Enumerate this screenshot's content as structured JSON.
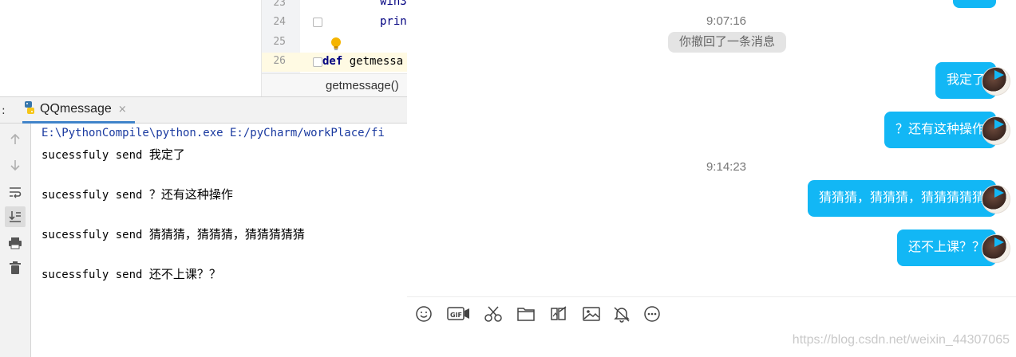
{
  "ide": {
    "editor": {
      "line_numbers": [
        "23",
        "24",
        "25",
        "26"
      ],
      "code_lines": [
        "win3",
        "prin"
      ],
      "def_keyword": "def",
      "def_name": "getmessa",
      "breadcrumb": "getmessage()"
    },
    "run_panel": {
      "colon": ":",
      "tab_label": "QQmessage",
      "tab_close": "×"
    },
    "console": {
      "command": "E:\\PythonCompile\\python.exe E:/pyCharm/workPlace/fi",
      "lines": [
        {
          "prefix": "sucessfuly send ",
          "msg": "我定了"
        },
        {
          "prefix": "sucessfuly send ",
          "msg": "？还有这种操作"
        },
        {
          "prefix": "sucessfuly send ",
          "msg": "猜猜猜，猜猜猜，猜猜猜猜猜"
        },
        {
          "prefix": "sucessfuly send ",
          "msg": "还不上课？？"
        }
      ]
    }
  },
  "chat": {
    "timestamp1": "9:07:16",
    "recall_notice": "你撤回了一条消息",
    "timestamp2": "9:14:23",
    "messages": [
      "我定了",
      "？还有这种操作",
      "猜猜猜，猜猜猜，猜猜猜猜猜",
      "还不上课？？"
    ],
    "toolbar_icons": [
      "emoji-icon",
      "gif-icon",
      "scissors-icon",
      "folder-icon",
      "image-edit-icon",
      "picture-icon",
      "bell-icon",
      "more-icon"
    ],
    "bubble_color": "#12b7f5"
  },
  "watermark": "https://blog.csdn.net/weixin_44307065"
}
